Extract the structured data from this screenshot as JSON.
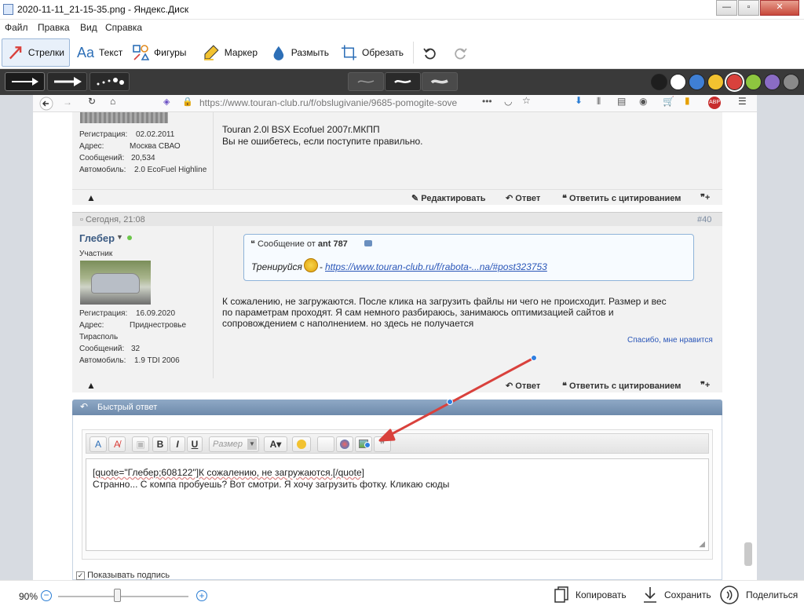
{
  "window": {
    "title": "2020-11-11_21-15-35.png - Яндекс.Диск"
  },
  "menu": {
    "items": [
      "Файл",
      "Правка",
      "Вид",
      "Справка"
    ]
  },
  "toolbar": {
    "tools": [
      "Стрелки",
      "Текст",
      "Фигуры",
      "Маркер",
      "Размыть",
      "Обрезать"
    ],
    "selected": "Стрелки"
  },
  "palette": {
    "colors": [
      "#1e1e1e",
      "#ffffff",
      "#3f7fd4",
      "#f2c230",
      "#d9413c",
      "#8ec63f",
      "#8a6cc4",
      "#8a8a8a"
    ],
    "selected": "#d9413c"
  },
  "browser": {
    "url": "https://www.touran-club.ru/f/obslugivanie/9685-pomogite-sove"
  },
  "post1": {
    "text1": "Touran 2.0l BSX Ecofuel 2007г.МКПП",
    "text2": "Вы не ошибетесь, если поступите правильно.",
    "info": [
      {
        "k": "Регистрация:",
        "v": "02.02.2011"
      },
      {
        "k": "Адрес:",
        "v": "Москва СВАО"
      },
      {
        "k": "Сообщений:",
        "v": "20,534"
      },
      {
        "k": "Автомобиль:",
        "v": "2.0 EcoFuel Highline"
      }
    ],
    "edit": "Редактировать",
    "reply": "Ответ",
    "quote_reply": "Ответить с цитированием"
  },
  "post2": {
    "date": "Сегодня, 21:08",
    "number": "#40",
    "user": "Глебер",
    "role": "Участник",
    "info": [
      {
        "k": "Регистрация:",
        "v": "16.09.2020"
      },
      {
        "k": "Адрес:",
        "v": "Приднестровье"
      },
      {
        "k": "",
        "v": "Тирасполь"
      },
      {
        "k": "Сообщений:",
        "v": "32"
      },
      {
        "k": "Автомобиль:",
        "v": "1.9 TDI 2006"
      }
    ],
    "quote_head": "Сообщение от",
    "quote_author": "ant 787",
    "quote_text": "Тренируйся",
    "quote_link": "https://www.touran-club.ru/f/rabota-...na/#post323753",
    "line1": "К сожалению, не загружаются. После клика на загрузить файлы ни чего не происходит. Размер и вес",
    "line2": "по параметрам проходят. Я сам немного разбираюсь, занимаюсь оптимизацией сайтов и",
    "line3": "сопровождением с наполнением. но здесь не получается",
    "thanks": "Спасибо, мне нравится",
    "reply": "Ответ",
    "quote_reply": "Ответить с цитированием"
  },
  "quickreply": {
    "title": "Быстрый ответ",
    "size_label": "Размер",
    "line1": "[quote=\"Глебер;608122\"]К сожалению, не загружаются.[/quote]",
    "line2": "Странно... С компа пробуешь? Вот смотри. Я хочу загрузить фотку. Кликаю сюды",
    "signature": "Показывать подпись"
  },
  "status": {
    "zoom": "90%",
    "zoom_level": 0.45,
    "copy": "Копировать",
    "save": "Сохранить",
    "share": "Поделиться"
  }
}
